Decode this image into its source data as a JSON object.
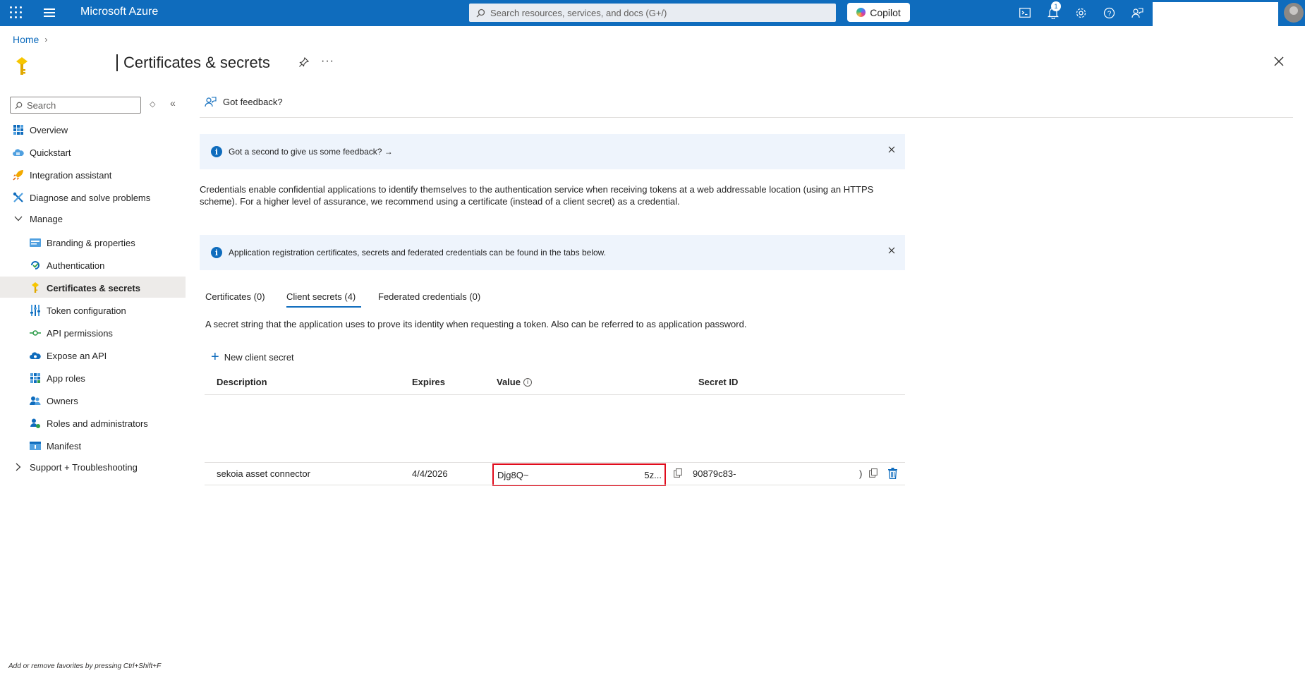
{
  "topbar": {
    "brand": "Microsoft Azure",
    "search_placeholder": "Search resources, services, and docs (G+/)",
    "copilot_label": "Copilot",
    "notification_count": "1"
  },
  "breadcrumb": {
    "home": "Home"
  },
  "page": {
    "title": "Certificates & secrets",
    "more": "···"
  },
  "sidebar": {
    "search_placeholder": "Search",
    "items": [
      {
        "label": "Overview"
      },
      {
        "label": "Quickstart"
      },
      {
        "label": "Integration assistant"
      },
      {
        "label": "Diagnose and solve problems"
      },
      {
        "label": "Manage"
      },
      {
        "label": "Branding & properties"
      },
      {
        "label": "Authentication"
      },
      {
        "label": "Certificates & secrets"
      },
      {
        "label": "Token configuration"
      },
      {
        "label": "API permissions"
      },
      {
        "label": "Expose an API"
      },
      {
        "label": "App roles"
      },
      {
        "label": "Owners"
      },
      {
        "label": "Roles and administrators"
      },
      {
        "label": "Manifest"
      },
      {
        "label": "Support + Troubleshooting"
      }
    ],
    "favorites_hint": "Add or remove favorites by pressing Ctrl+Shift+F"
  },
  "main": {
    "feedback_label": "Got feedback?",
    "info_feedback": "Got a second to give us some feedback? →",
    "description": "Credentials enable confidential applications to identify themselves to the authentication service when receiving tokens at a web addressable location (using an HTTPS scheme). For a higher level of assurance, we recommend using a certificate (instead of a client secret) as a credential.",
    "info_tabs": "Application registration certificates, secrets and federated credentials can be found in the tabs below.",
    "tabs": [
      {
        "label": "Certificates (0)"
      },
      {
        "label": "Client secrets (4)"
      },
      {
        "label": "Federated credentials (0)"
      }
    ],
    "tab_description": "A secret string that the application uses to prove its identity when requesting a token. Also can be referred to as application password.",
    "new_secret_label": "New client secret",
    "columns": {
      "description": "Description",
      "expires": "Expires",
      "value": "Value",
      "secret_id": "Secret ID"
    },
    "row": {
      "description": "sekoia asset connector",
      "expires": "4/4/2026",
      "value_start": "Djg8Q~",
      "value_end": "5z...",
      "secret_id": "90879c83-",
      "secret_id_end": ")"
    }
  },
  "colors": {
    "azure_blue": "#0f6cbd",
    "highlight_red": "#e00b1c",
    "selected_bg": "#edebe9"
  }
}
